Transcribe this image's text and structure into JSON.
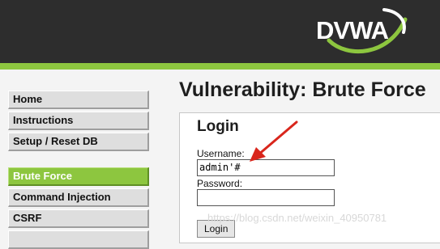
{
  "header": {
    "logo_text": "DVWA",
    "brand_color": "#8dc63f",
    "background_color": "#2d2d2d"
  },
  "menu": {
    "items": [
      {
        "label": "Home",
        "selected": false
      },
      {
        "label": "Instructions",
        "selected": false
      },
      {
        "label": "Setup / Reset DB",
        "selected": false
      },
      {
        "label": "Brute Force",
        "selected": true
      },
      {
        "label": "Command Injection",
        "selected": false
      },
      {
        "label": "CSRF",
        "selected": false
      },
      {
        "label": "",
        "selected": false
      }
    ]
  },
  "main": {
    "title": "Vulnerability: Brute Force",
    "form": {
      "heading": "Login",
      "username_label": "Username:",
      "username_value": "admin'#",
      "password_label": "Password:",
      "password_value": "",
      "login_label": "Login"
    }
  },
  "annotation": {
    "arrow_color": "#d9261c"
  },
  "watermark": "https://blog.csdn.net/weixin_40950781"
}
